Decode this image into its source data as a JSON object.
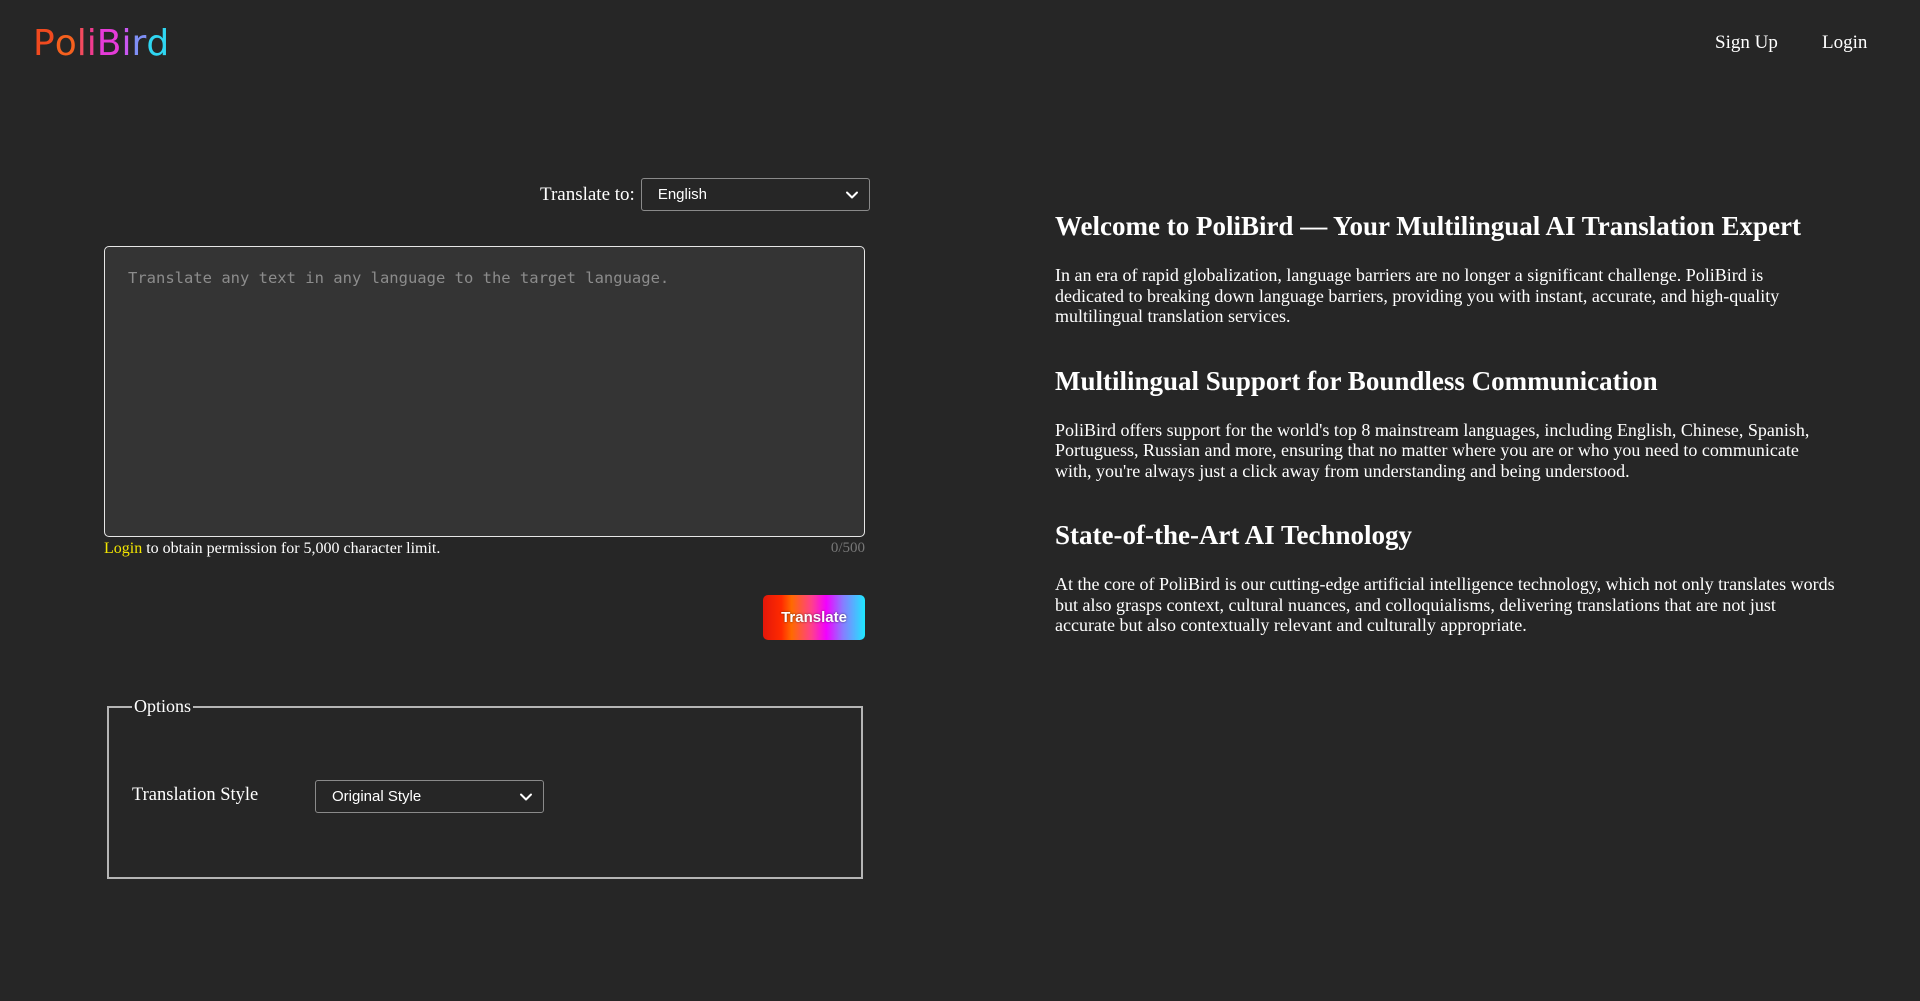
{
  "header": {
    "logo_letters": [
      {
        "char": "P",
        "color": "#f04a1f"
      },
      {
        "char": "o",
        "color": "#f5601e"
      },
      {
        "char": "l",
        "color": "#f24a5e"
      },
      {
        "char": "i",
        "color": "#ef3b8f"
      },
      {
        "char": "B",
        "color": "#e53bd8"
      },
      {
        "char": "i",
        "color": "#c857f0"
      },
      {
        "char": "r",
        "color": "#7f8ff5"
      },
      {
        "char": "d",
        "color": "#2fd6f2"
      }
    ],
    "nav": {
      "signup": "Sign Up",
      "login": "Login"
    }
  },
  "translator": {
    "translate_to_label": "Translate to:",
    "target_language": "English",
    "input_placeholder": "Translate any text in any language to the target language.",
    "login_link": "Login",
    "limit_text": " to obtain permission for 5,000 character limit.",
    "char_counter": "0/500",
    "translate_button": "Translate",
    "button_gradient": [
      "#e3170a",
      "#ff6a00",
      "#f200ff",
      "#1ee8ff"
    ]
  },
  "options": {
    "legend": "Options",
    "style_label": "Translation Style",
    "style_value": "Original Style"
  },
  "intro": {
    "sections": [
      {
        "heading": "Welcome to PoliBird — Your Multilingual AI Translation Expert",
        "body": "In an era of rapid globalization, language barriers are no longer a significant challenge. PoliBird is dedicated to breaking down language barriers, providing you with instant, accurate, and high-quality multilingual translation services."
      },
      {
        "heading": "Multilingual Support for Boundless Communication",
        "body": "PoliBird offers support for the world's top 8 mainstream languages, including English, Chinese, Spanish, Portuguess, Russian and more, ensuring that no matter where you are or who you need to communicate with, you're always just a click away from understanding and being understood."
      },
      {
        "heading": "State-of-the-Art AI Technology",
        "body": "At the core of PoliBird is our cutting-edge artificial intelligence technology, which not only translates words but also grasps context, cultural nuances, and colloquialisms, delivering translations that are not just accurate but also contextually relevant and culturally appropriate."
      }
    ]
  },
  "colors": {
    "background": "#262626",
    "textarea_bg": "#343434",
    "login_highlight": "#f3e600"
  }
}
